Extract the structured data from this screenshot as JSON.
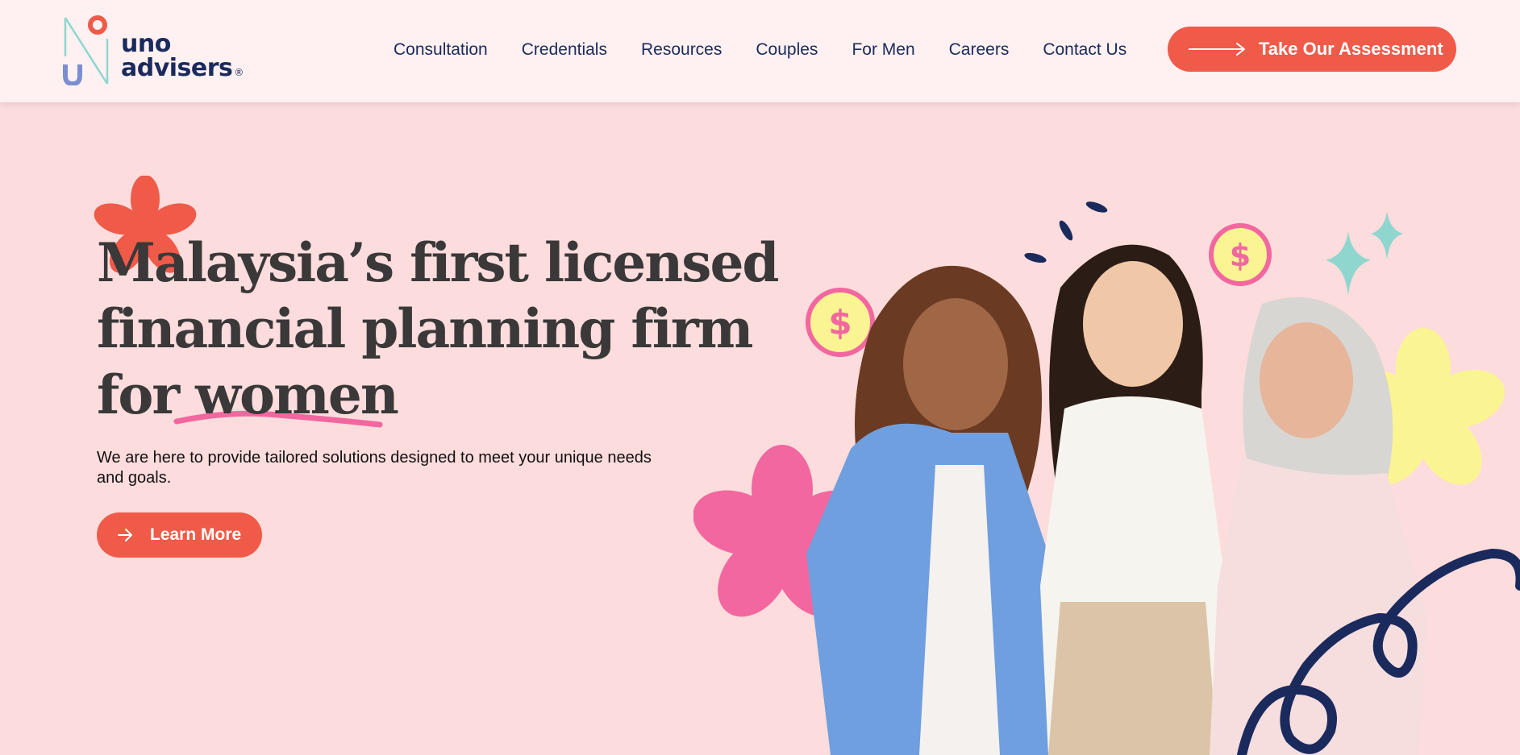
{
  "brand": {
    "logo_line1": "uno",
    "logo_line2": "advisers",
    "registered_mark": "®",
    "colors": {
      "primary_coral": "#ef5a49",
      "navy": "#1b2a5c",
      "header_bg": "#fff1f1",
      "page_bg": "#fcdcdc",
      "accent_pink": "#f2679f",
      "accent_yellow": "#fbf493",
      "accent_teal": "#8fd6cf",
      "logo_blue": "#7b8fd0"
    }
  },
  "nav": {
    "items": [
      {
        "label": "Consultation"
      },
      {
        "label": "Credentials"
      },
      {
        "label": "Resources"
      },
      {
        "label": "Couples"
      },
      {
        "label": "For Men"
      },
      {
        "label": "Careers"
      },
      {
        "label": "Contact Us"
      }
    ],
    "cta_label": "Take Our Assessment",
    "cta_icon": "arrow-right-icon"
  },
  "hero": {
    "headline_line1": "Malaysia’s first licensed",
    "headline_line2": "financial planning firm",
    "headline_line3": "for women",
    "subtext": "We are here to provide tailored solutions designed to meet your unique needs and goals.",
    "button_label": "Learn More",
    "button_icon": "arrow-right-icon",
    "decorations": [
      "red-flower-icon",
      "pink-underline-stroke",
      "dollar-coin-icon",
      "sparkle-icon",
      "pink-flower-icon",
      "yellow-flower-icon",
      "navy-swirl-icon"
    ]
  }
}
